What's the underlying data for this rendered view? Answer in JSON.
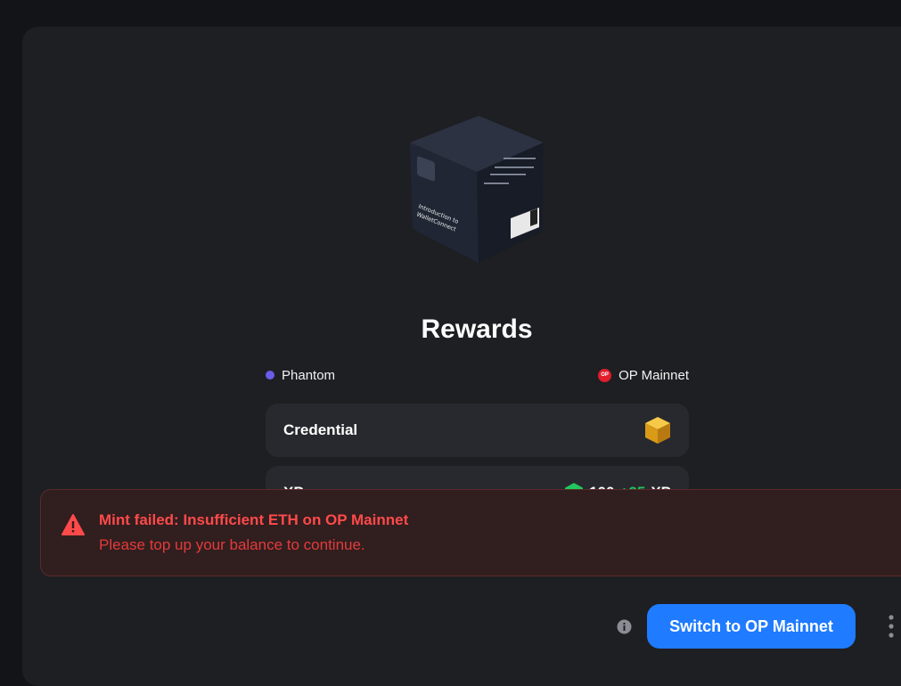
{
  "cube": {
    "title_line1": "Introduction to",
    "title_line2": "WalletConnect"
  },
  "page": {
    "title": "Rewards"
  },
  "meta": {
    "wallet": "Phantom",
    "network": "OP Mainnet",
    "network_badge": "OP"
  },
  "rewards": {
    "credential_label": "Credential",
    "xp_label": "XP",
    "xp_base": "100",
    "xp_bonus": "+25",
    "xp_unit": "XP"
  },
  "error": {
    "title": "Mint failed: Insufficient ETH on OP Mainnet",
    "message": "Please top up your balance to continue."
  },
  "actions": {
    "switch_label": "Switch to OP Mainnet"
  },
  "colors": {
    "accent": "#1f7bff",
    "error": "#ff4a4a",
    "xp_bonus": "#22c55e",
    "wallet_dot": "#6b5ce7",
    "op_red": "#e11d2c"
  },
  "icons": [
    "credential-cube-icon",
    "xp-hex-icon",
    "warning-icon",
    "info-icon",
    "more-vertical-icon"
  ]
}
